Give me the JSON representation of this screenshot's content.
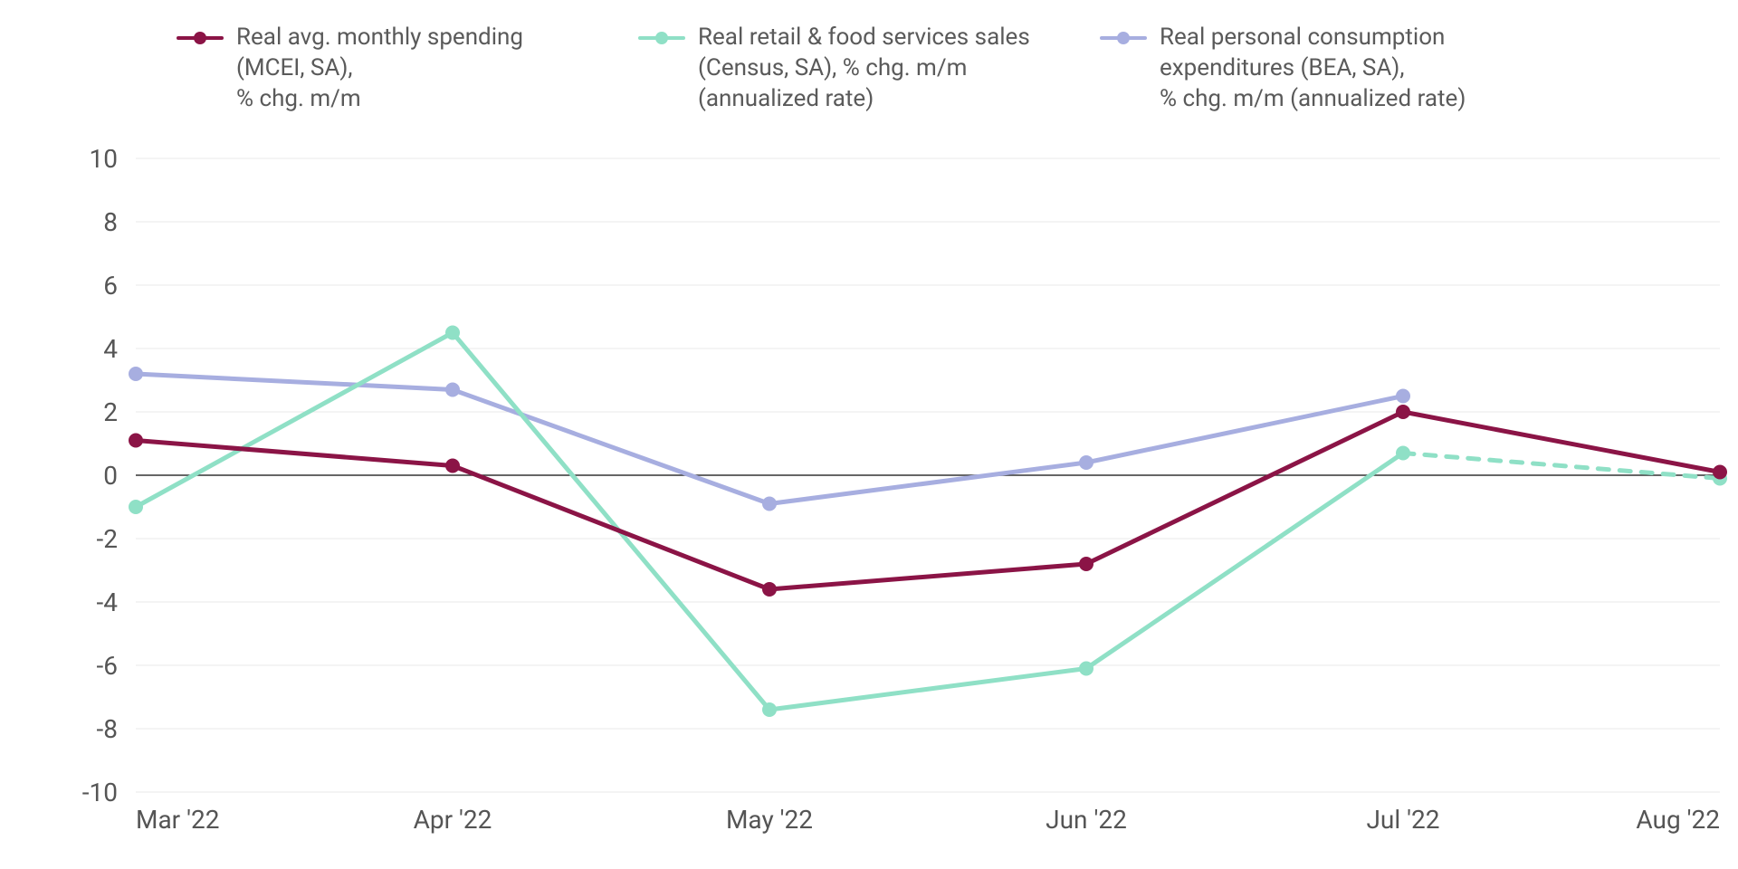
{
  "chart_data": {
    "type": "line",
    "categories": [
      "Mar '22",
      "Apr '22",
      "May '22",
      "Jun '22",
      "Jul '22",
      "Aug '22"
    ],
    "ylim": [
      -10,
      10
    ],
    "yticks": [
      -10,
      -8,
      -6,
      -4,
      -2,
      0,
      2,
      4,
      6,
      8,
      10
    ],
    "series": [
      {
        "name": "Real avg. monthly spending (MCEI, SA), % chg. m/m",
        "color": "#8b1446",
        "values": [
          1.1,
          0.3,
          -3.6,
          -2.8,
          2.0,
          0.1
        ]
      },
      {
        "name": "Real retail & food services sales (Census, SA), % chg. m/m (annualized rate)",
        "color": "#8fe0c6",
        "values": [
          -1.0,
          4.5,
          -7.4,
          -6.1,
          0.7,
          -0.1
        ],
        "dashed_from_index": 4
      },
      {
        "name": "Real personal consumption expenditures (BEA, SA), % chg. m/m (annualized rate)",
        "color": "#a7aee0",
        "values": [
          3.2,
          2.7,
          -0.9,
          0.4,
          2.5,
          null
        ]
      }
    ]
  },
  "legend": {
    "items": [
      {
        "label": "Real avg. monthly spending (MCEI, SA),\n% chg. m/m",
        "color": "#8b1446"
      },
      {
        "label": "Real retail & food services sales (Census, SA), % chg. m/m (annualized rate)",
        "color": "#8fe0c6"
      },
      {
        "label": "Real personal consumption expenditures (BEA, SA),\n% chg. m/m (annualized rate)",
        "color": "#a7aee0"
      }
    ]
  }
}
